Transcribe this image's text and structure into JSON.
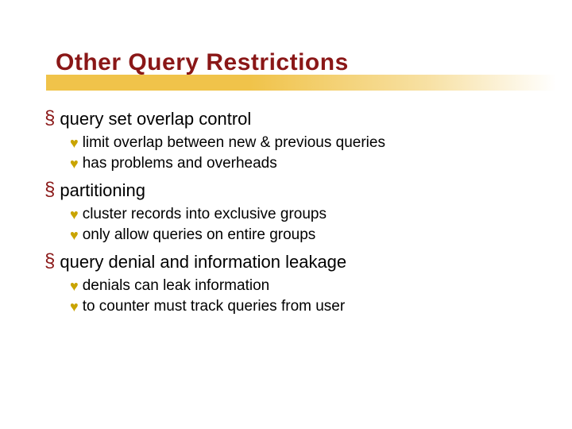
{
  "title": "Other Query Restrictions",
  "bullets": {
    "section_symbol": "§",
    "heart_symbol": "♥"
  },
  "items": [
    {
      "label": "query set overlap control",
      "sub": [
        "limit overlap between new & previous queries",
        "has problems and overheads"
      ]
    },
    {
      "label": "partitioning",
      "sub": [
        "cluster records into exclusive groups",
        "only allow queries on entire groups"
      ]
    },
    {
      "label": "query denial and information leakage",
      "sub": [
        "denials can leak information",
        "to counter must track queries from user"
      ]
    }
  ]
}
